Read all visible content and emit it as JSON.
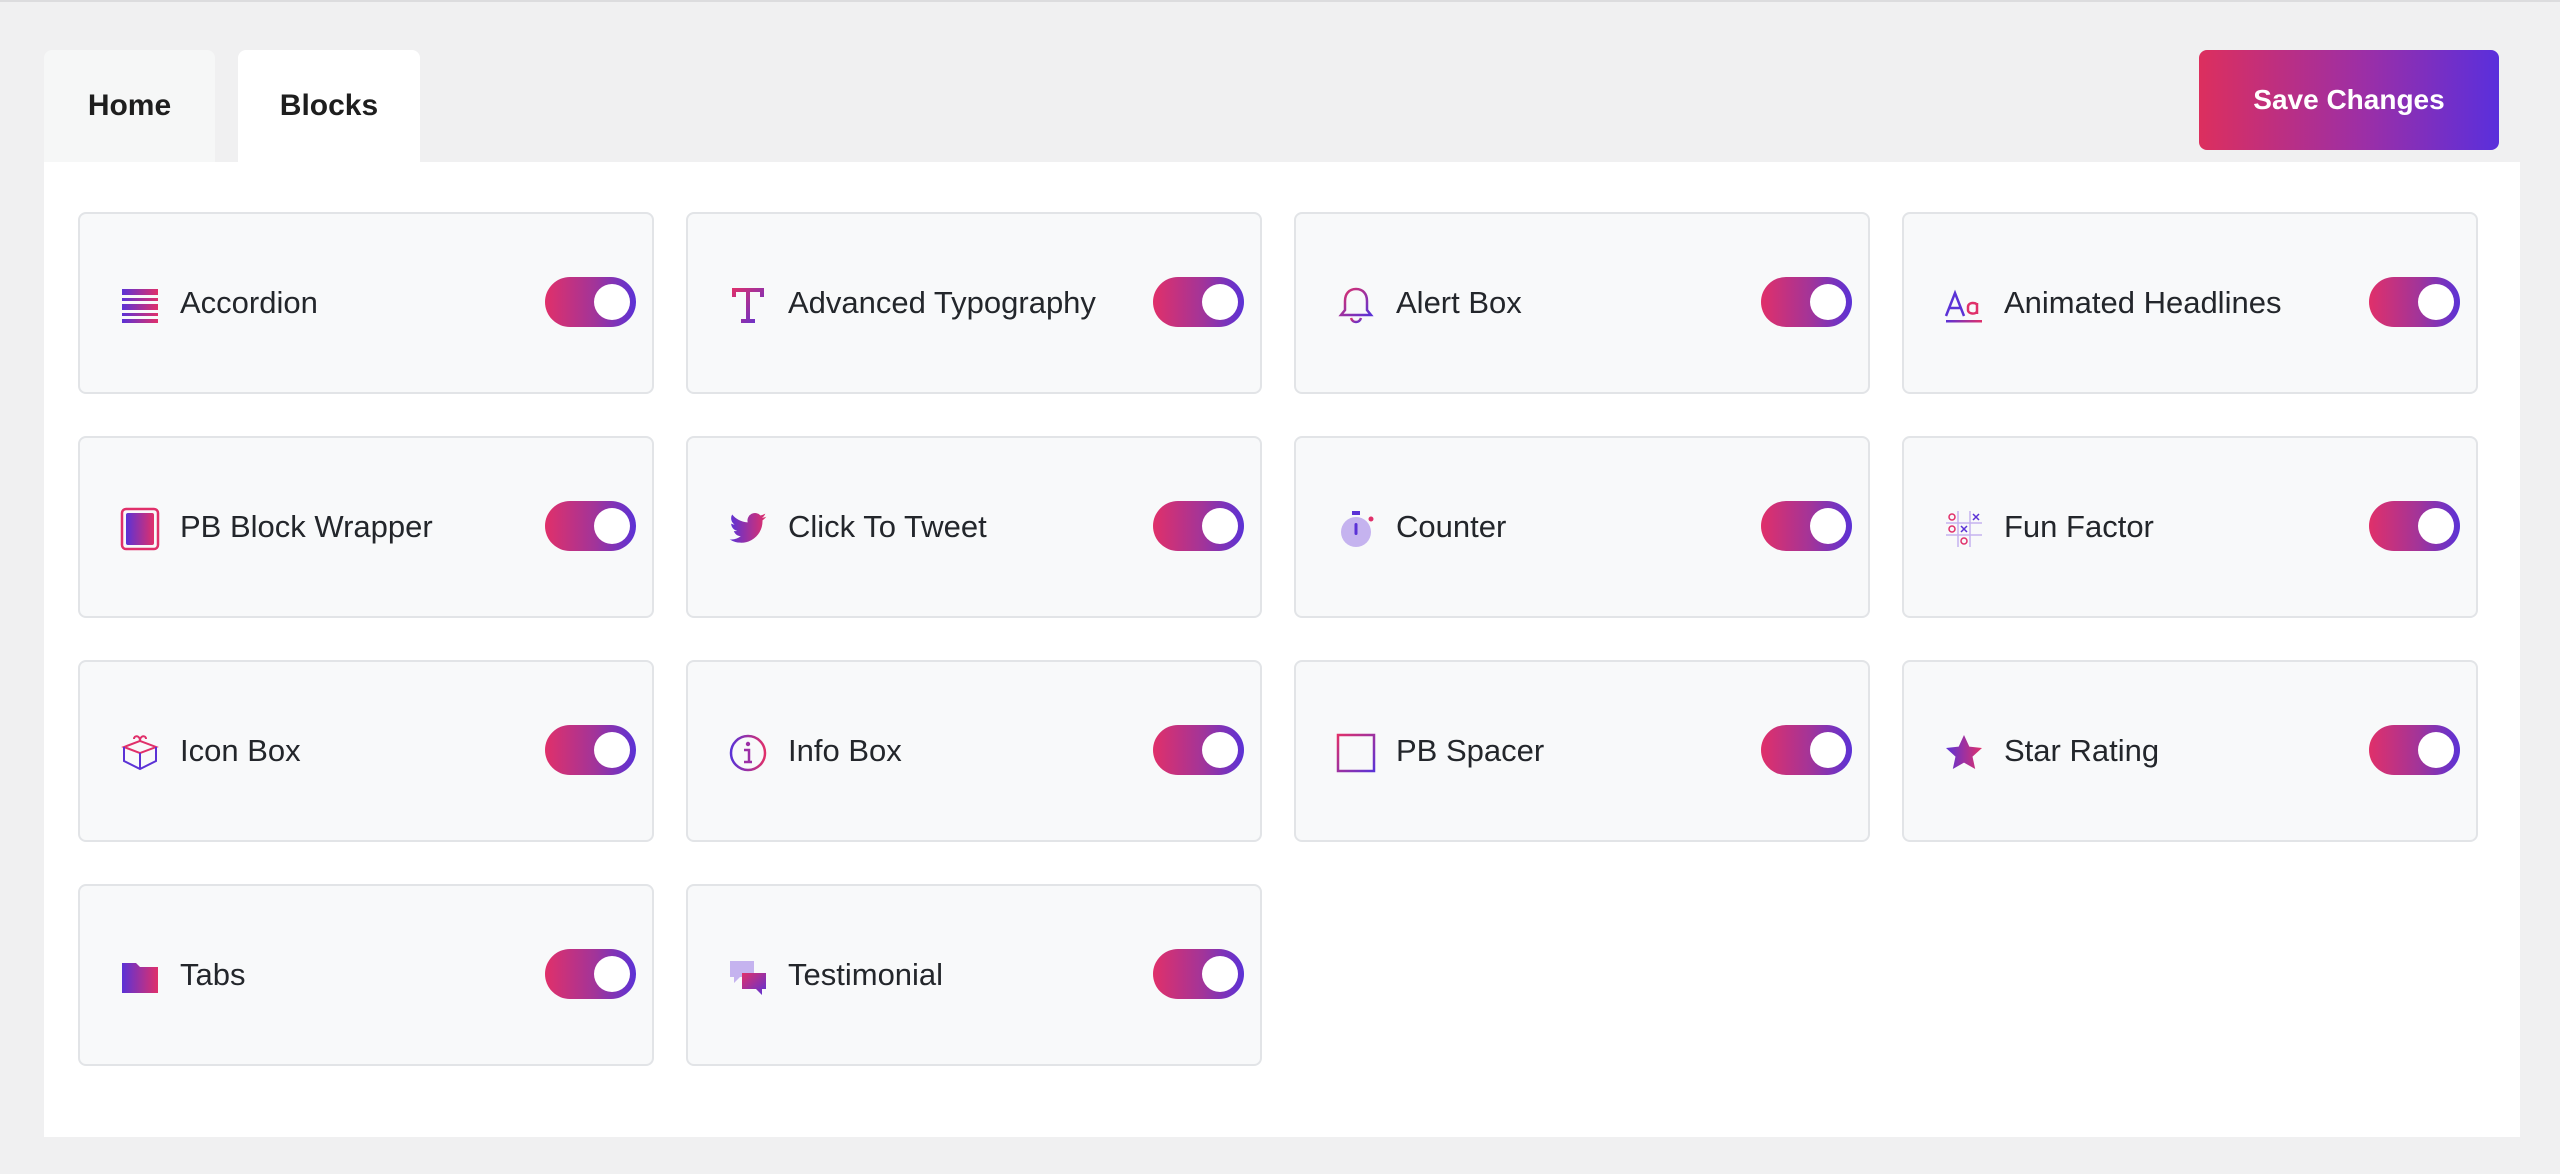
{
  "tabs": [
    {
      "label": "Home",
      "active": false
    },
    {
      "label": "Blocks",
      "active": true
    }
  ],
  "save_button": {
    "label": "Save Changes"
  },
  "accent_gradient": [
    "#e0306a",
    "#5b32d6"
  ],
  "blocks": [
    {
      "label": "Accordion",
      "icon": "accordion-icon",
      "enabled": true
    },
    {
      "label": "Advanced Typography",
      "icon": "typography-icon",
      "enabled": true
    },
    {
      "label": "Alert Box",
      "icon": "bell-icon",
      "enabled": true
    },
    {
      "label": "Animated Headlines",
      "icon": "headline-icon",
      "enabled": true
    },
    {
      "label": "PB Block Wrapper",
      "icon": "block-wrapper-icon",
      "enabled": true
    },
    {
      "label": "Click To Tweet",
      "icon": "twitter-bird-icon",
      "enabled": true
    },
    {
      "label": "Counter",
      "icon": "stopwatch-icon",
      "enabled": true
    },
    {
      "label": "Fun Factor",
      "icon": "tic-tac-toe-icon",
      "enabled": true
    },
    {
      "label": "Icon Box",
      "icon": "gift-box-icon",
      "enabled": true
    },
    {
      "label": "Info Box",
      "icon": "info-circle-icon",
      "enabled": true
    },
    {
      "label": "PB Spacer",
      "icon": "spacer-square-icon",
      "enabled": true
    },
    {
      "label": "Star Rating",
      "icon": "star-icon",
      "enabled": true
    },
    {
      "label": "Tabs",
      "icon": "folder-tab-icon",
      "enabled": true
    },
    {
      "label": "Testimonial",
      "icon": "chat-bubbles-icon",
      "enabled": true
    }
  ]
}
